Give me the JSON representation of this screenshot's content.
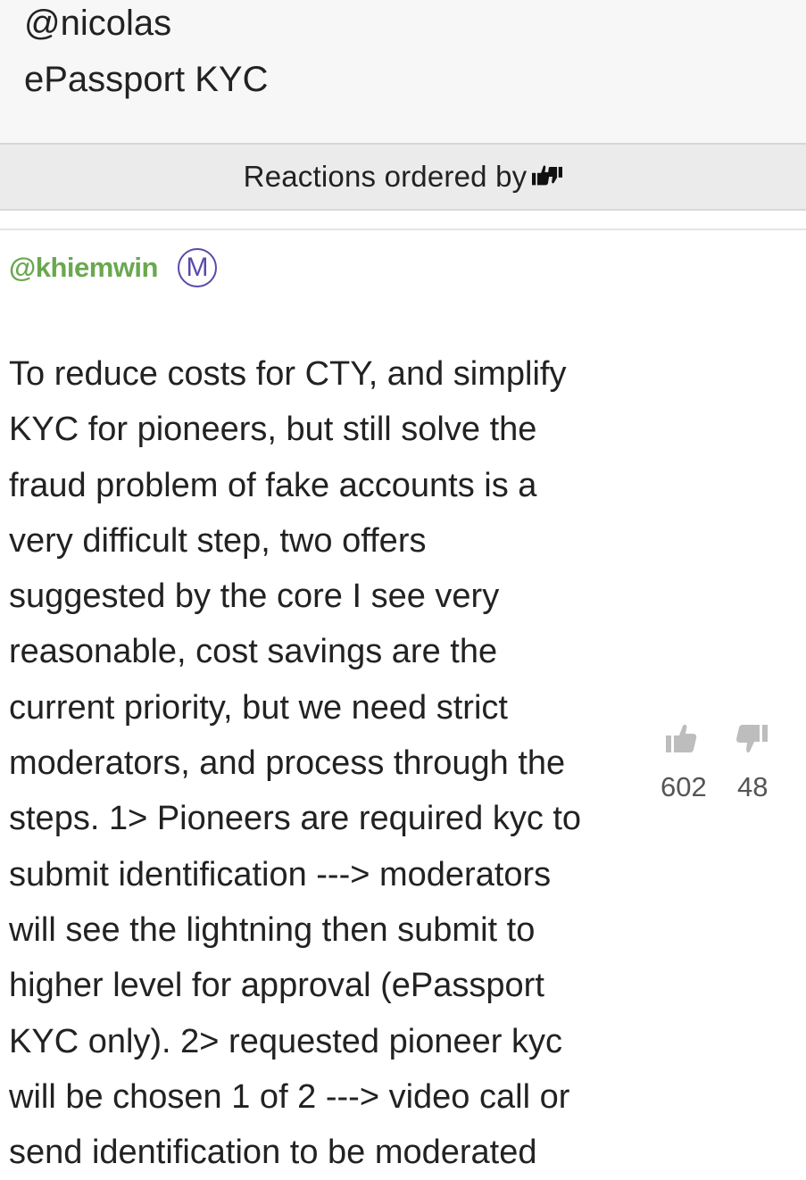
{
  "post": {
    "handle": "@nicolas",
    "title": "ePassport KYC"
  },
  "reactions": {
    "label": "Reactions ordered by",
    "order_icon": "thumbs-up-down-icon"
  },
  "comment": {
    "author": "@khiemwin",
    "badge": "M",
    "lines": [
      "To reduce costs for CTY, and simplify",
      "KYC for pioneers, but still solve the",
      "fraud problem of fake accounts is a",
      "very difficult step, two offers",
      "suggested by the core I see very",
      "reasonable, cost savings are the",
      "current priority, but we need strict",
      "moderators, and process through the",
      "steps. 1> Pioneers are required kyc to",
      "submit identification ---> moderators",
      "will see the lightning then submit to",
      "higher level for approval (ePassport",
      "KYC only). 2> requested pioneer kyc",
      "will be chosen 1 of 2 ---> video call or",
      "send identification to be moderated"
    ],
    "upvotes": "602",
    "downvotes": "48"
  },
  "colors": {
    "author": "#6aa84f",
    "badge": "#5a4aa8",
    "vote_icon": "#bdbdbd"
  }
}
